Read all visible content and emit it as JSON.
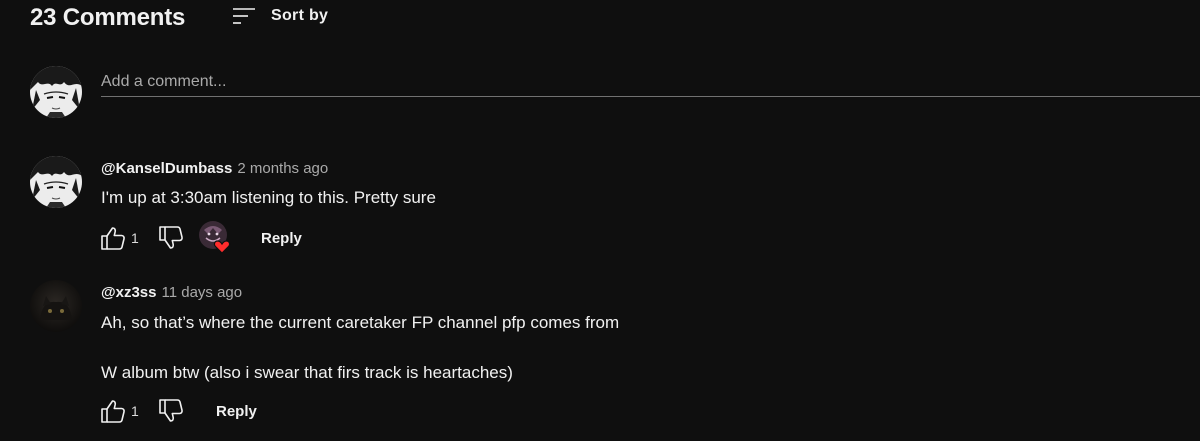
{
  "header": {
    "count_title": "23 Comments",
    "sort_label": "Sort by",
    "sort_icon": "sort-icon"
  },
  "add_comment": {
    "placeholder": "Add a comment..."
  },
  "comments": [
    {
      "author": "@KanselDumbass",
      "time": "2 months ago",
      "text_lines": [
        "I'm up at 3:30am listening to this. Pretty sure"
      ],
      "likes": "1",
      "reply_label": "Reply",
      "creator_heart": true
    },
    {
      "author": "@xz3ss",
      "time": "11 days ago",
      "text_lines": [
        "Ah, so that’s where the current caretaker FP channel pfp comes from",
        "W album btw (also i swear that firs track is heartaches)"
      ],
      "likes": "1",
      "reply_label": "Reply",
      "creator_heart": false
    }
  ],
  "colors": {
    "background": "#0f0f0f",
    "text_primary": "#f1f1f1",
    "text_secondary": "#aaaaaa",
    "heart": "#ff2d2d"
  }
}
